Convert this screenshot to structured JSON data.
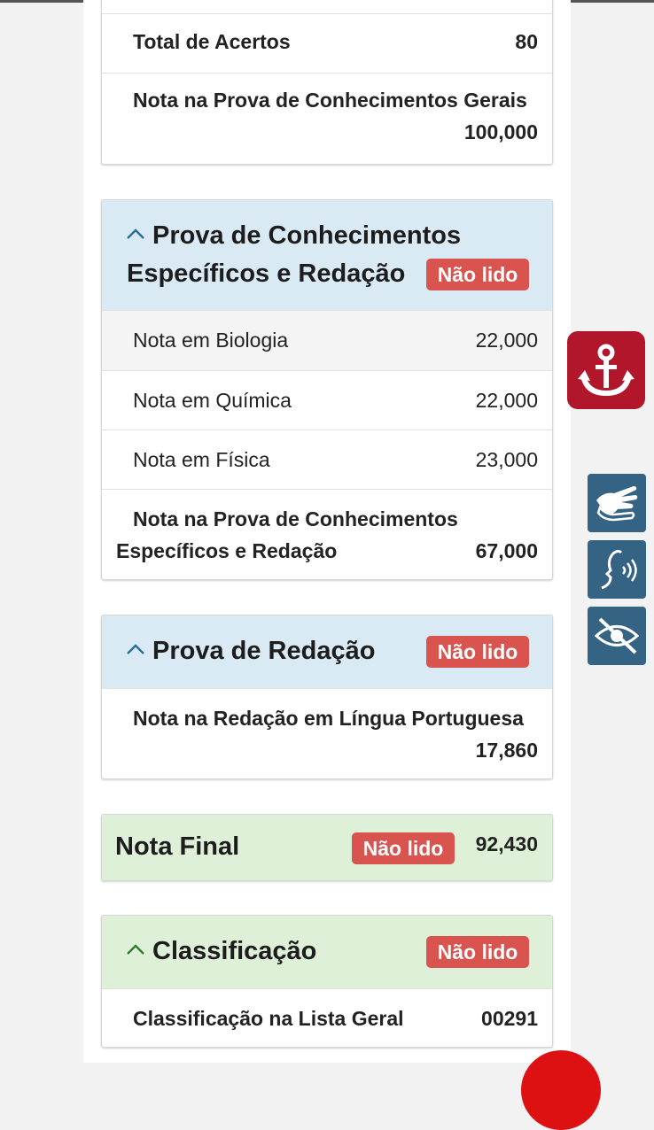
{
  "section_gerais": {
    "total_label": "Total de Acertos",
    "total_value": "80",
    "nota_label": "Nota na Prova de Conhecimentos Gerais",
    "nota_value": "100,000"
  },
  "section_especificos": {
    "title_line1": "Prova de Conhecimentos",
    "title_line2": "Específicos e Redação",
    "badge": "Não lido",
    "rows": [
      {
        "label": "Nota em Biologia",
        "value": "22,000"
      },
      {
        "label": "Nota em Química",
        "value": "22,000"
      },
      {
        "label": "Nota em Física",
        "value": "23,000"
      }
    ],
    "total_line1": "Nota na Prova de Conhecimentos",
    "total_line2": "Específicos e Redação",
    "total_value": "67,000"
  },
  "section_redacao": {
    "title": "Prova de Redação",
    "badge": "Não lido",
    "nota_label": "Nota na Redação em Língua Portuguesa",
    "nota_value": "17,860"
  },
  "nota_final": {
    "title": "Nota Final",
    "badge": "Não lido",
    "value": "92,430"
  },
  "classificacao": {
    "title": "Classificação",
    "badge": "Não lido",
    "label": "Classificação na Lista Geral",
    "value": "00291"
  },
  "sidebar": {
    "icons": [
      "anchor-icon",
      "sign-language-icon",
      "audio-voice-icon",
      "low-vision-icon"
    ]
  },
  "colors": {
    "badge": "#d9534f",
    "header_blue": "#d9eaf5",
    "header_green": "#dff0d8",
    "anchor_button": "#b1162a",
    "accessibility_button": "#346383"
  }
}
